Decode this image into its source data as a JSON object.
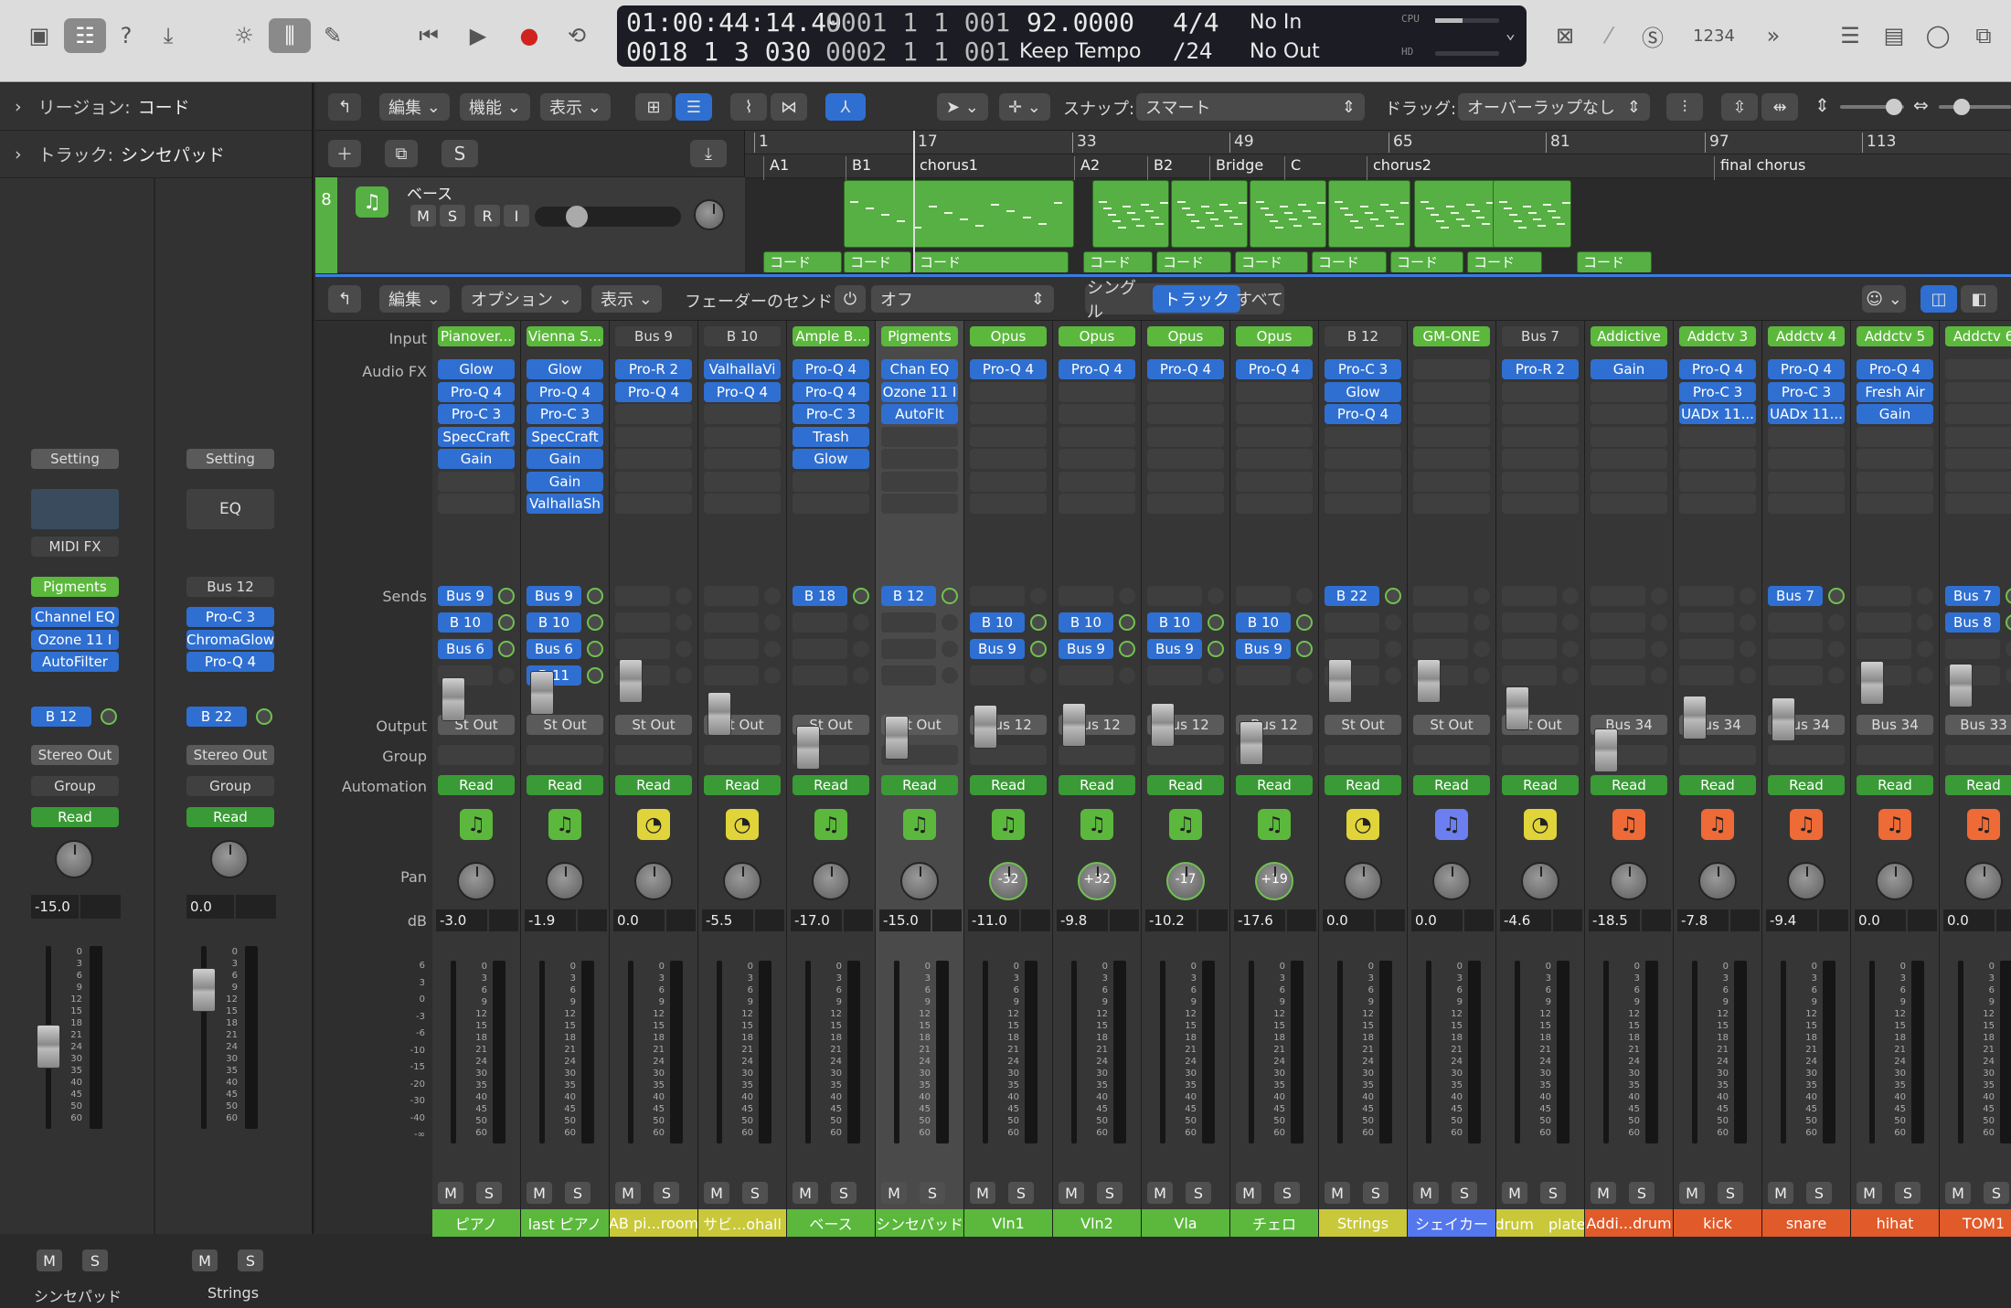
{
  "lcd": {
    "time": "01:00:44:14.49",
    "bars_a": "0001  1  1  001",
    "tempo": "92.0000",
    "sig": "4/4",
    "in": "No In",
    "beats": "0018  1  3  030",
    "bars_b": "0002  1  1  001",
    "keep": "Keep Tempo",
    "div": "/24",
    "out": "No Out",
    "cpu": "CPU",
    "hd": "HD"
  },
  "toolbar_right": {
    "count": "1234",
    "more": "»"
  },
  "inspector": {
    "region_label": "リージョン:",
    "region_value": "コード",
    "track_label": "トラック:",
    "track_value": "シンセパッド"
  },
  "trackbar": {
    "edit": "編集",
    "func": "機能",
    "view": "表示",
    "snap_label": "スナップ:",
    "snap_value": "スマート",
    "drag_label": "ドラッグ:",
    "drag_value": "オーバーラップなし"
  },
  "track": {
    "num": "8",
    "name": "ベース",
    "m": "M",
    "s": "S",
    "r": "R",
    "i": "I",
    "s_btn": "S"
  },
  "ruler": [
    "1",
    "17",
    "33",
    "49",
    "65",
    "81",
    "97",
    "113"
  ],
  "markers": [
    "A1",
    "B1",
    "chorus1",
    "A2",
    "B2",
    "Bridge",
    "C",
    "chorus2",
    "final chorus"
  ],
  "chord_regions": [
    "コード",
    "コード",
    "コード",
    "コード",
    "コード",
    "コード",
    "コード",
    "コード",
    "コード",
    "コード"
  ],
  "mixerbar": {
    "edit": "編集",
    "options": "オプション",
    "view": "表示",
    "send_label": "フェーダーのセンド:",
    "send_value": "オフ",
    "single": "シングル",
    "track": "トラック",
    "all": "すべて"
  },
  "rowlabels": {
    "input": "Input",
    "fx": "Audio FX",
    "sends": "Sends",
    "output": "Output",
    "group": "Group",
    "automation": "Automation",
    "pan": "Pan",
    "db": "dB"
  },
  "inspector_strips": [
    {
      "setting": "Setting",
      "midifx": "MIDI FX",
      "input": "Pigments",
      "fx": [
        "Channel EQ",
        "Ozone 11 I",
        "AutoFilter"
      ],
      "send": "B 12",
      "output": "Stereo Out",
      "group": "Group",
      "auto": "Read",
      "db": "-15.0",
      "m": "M",
      "s": "S",
      "name": "シンセパッド"
    },
    {
      "setting": "Setting",
      "eq": "EQ",
      "input": "Bus 12",
      "fx": [
        "Pro-C 3",
        "ChromaGlow",
        "Pro-Q 4"
      ],
      "send": "B 22",
      "output": "Stereo Out",
      "group": "Group",
      "auto": "Read",
      "db": "0.0",
      "m": "M",
      "s": "S",
      "name": "Strings"
    }
  ],
  "strips": [
    {
      "input": "Pianover...",
      "fx": [
        "Glow",
        "Pro-Q 4",
        "Pro-C 3",
        "SpecCraft",
        "Gain"
      ],
      "sends": [
        "Bus 9",
        "B 10",
        "Bus 6",
        ""
      ],
      "output": "St Out",
      "auto": "Read",
      "pan": "",
      "db": "-3.0",
      "name": "ピアノ",
      "color": "#5bb83c",
      "icon": "♫",
      "iconbg": "#5bb83c"
    },
    {
      "input": "Vienna S...",
      "fx": [
        "Glow",
        "Pro-Q 4",
        "Pro-C 3",
        "SpecCraft",
        "Gain",
        "Gain",
        "ValhallaSh"
      ],
      "sends": [
        "Bus 9",
        "B 10",
        "Bus 6",
        "B 11"
      ],
      "output": "St Out",
      "auto": "Read",
      "pan": "",
      "db": "-1.9",
      "name": "last ピアノ",
      "color": "#5bb83c",
      "icon": "♫",
      "iconbg": "#5bb83c"
    },
    {
      "input": "Bus 9",
      "fx": [
        "Pro-R 2",
        "Pro-Q 4"
      ],
      "sends": [
        "",
        "",
        "",
        ""
      ],
      "output": "St Out",
      "auto": "Read",
      "pan": "",
      "db": "0.0",
      "name": "AB pi...room",
      "color": "#c8c83a",
      "icon": "◔",
      "iconbg": "#e0d43a"
    },
    {
      "input": "B 10",
      "fx": [
        "ValhallaVi",
        "Pro-Q 4"
      ],
      "sends": [
        "",
        "",
        "",
        ""
      ],
      "output": "St Out",
      "auto": "Read",
      "pan": "",
      "db": "-5.5",
      "name": "サビ...ohall",
      "color": "#c8c83a",
      "icon": "◔",
      "iconbg": "#e0d43a"
    },
    {
      "input": "Ample B...",
      "fx": [
        "Pro-Q 4",
        "Pro-Q 4",
        "Pro-C 3",
        "Trash",
        "Glow"
      ],
      "sends": [
        "B 18",
        "",
        "",
        ""
      ],
      "output": "St Out",
      "auto": "Read",
      "pan": "",
      "db": "-17.0",
      "name": "ベース",
      "color": "#5bb83c",
      "icon": "♫",
      "iconbg": "#5bb83c"
    },
    {
      "input": "Pigments",
      "fx": [
        "Chan EQ",
        "Ozone 11 I",
        "AutoFlt"
      ],
      "sends": [
        "B 12",
        "",
        "",
        ""
      ],
      "output": "St Out",
      "auto": "Read",
      "pan": "",
      "db": "-15.0",
      "name": "シンセパッド",
      "color": "#5bb83c",
      "icon": "♫",
      "iconbg": "#5bb83c"
    },
    {
      "input": "Opus",
      "fx": [
        "Pro-Q 4"
      ],
      "sends": [
        "",
        "B 10",
        "Bus 9",
        ""
      ],
      "output": "Bus 12",
      "auto": "Read",
      "pan": "-32",
      "db": "-11.0",
      "name": "Vln1",
      "color": "#5bb83c",
      "icon": "♫",
      "iconbg": "#5bb83c"
    },
    {
      "input": "Opus",
      "fx": [
        "Pro-Q 4"
      ],
      "sends": [
        "",
        "B 10",
        "Bus 9",
        ""
      ],
      "output": "Bus 12",
      "auto": "Read",
      "pan": "+32",
      "db": "-9.8",
      "name": "Vln2",
      "color": "#5bb83c",
      "icon": "♫",
      "iconbg": "#5bb83c"
    },
    {
      "input": "Opus",
      "fx": [
        "Pro-Q 4"
      ],
      "sends": [
        "",
        "B 10",
        "Bus 9",
        ""
      ],
      "output": "Bus 12",
      "auto": "Read",
      "pan": "-17",
      "db": "-10.2",
      "name": "Vla",
      "color": "#5bb83c",
      "icon": "♫",
      "iconbg": "#5bb83c"
    },
    {
      "input": "Opus",
      "fx": [
        "Pro-Q 4"
      ],
      "sends": [
        "",
        "B 10",
        "Bus 9",
        ""
      ],
      "output": "Bus 12",
      "auto": "Read",
      "pan": "+19",
      "db": "-17.6",
      "name": "チェロ",
      "color": "#5bb83c",
      "icon": "♫",
      "iconbg": "#5bb83c"
    },
    {
      "input": "B 12",
      "fx": [
        "Pro-C 3",
        "Glow",
        "Pro-Q 4"
      ],
      "sends": [
        "B 22",
        "",
        "",
        ""
      ],
      "output": "St Out",
      "auto": "Read",
      "pan": "",
      "db": "0.0",
      "name": "Strings",
      "color": "#c8c83a",
      "icon": "◔",
      "iconbg": "#e0d43a"
    },
    {
      "input": "GM-ONE",
      "fx": [],
      "sends": [
        "",
        "",
        "",
        ""
      ],
      "output": "St Out",
      "auto": "Read",
      "pan": "",
      "db": "0.0",
      "name": "シェイカー",
      "color": "#5577ee",
      "icon": "♫",
      "iconbg": "#6b7ff0"
    },
    {
      "input": "Bus 7",
      "fx": [
        "Pro-R 2"
      ],
      "sends": [
        "",
        "",
        "",
        ""
      ],
      "output": "St Out",
      "auto": "Read",
      "pan": "",
      "db": "-4.6",
      "name": "drum　plate",
      "color": "#c8c83a",
      "icon": "◔",
      "iconbg": "#e0d43a"
    },
    {
      "input": "Addictive",
      "fx": [
        "Gain"
      ],
      "sends": [
        "",
        "",
        "",
        ""
      ],
      "output": "Bus 34",
      "auto": "Read",
      "pan": "",
      "db": "-18.5",
      "name": "Addi...drum",
      "color": "#e05a2a",
      "icon": "♫",
      "iconbg": "#ee6a36"
    },
    {
      "input": "Addctv 3",
      "fx": [
        "Pro-Q 4",
        "Pro-C 3",
        "UADx 11..."
      ],
      "sends": [
        "",
        "",
        "",
        ""
      ],
      "output": "Bus 34",
      "auto": "Read",
      "pan": "",
      "db": "-7.8",
      "name": "kick",
      "color": "#e05a2a",
      "icon": "♫",
      "iconbg": "#ee6a36"
    },
    {
      "input": "Addctv 4",
      "fx": [
        "Pro-Q 4",
        "Pro-C 3",
        "UADx 11..."
      ],
      "sends": [
        "Bus 7",
        "",
        "",
        ""
      ],
      "output": "Bus 34",
      "auto": "Read",
      "pan": "",
      "db": "-9.4",
      "name": "snare",
      "color": "#e05a2a",
      "icon": "♫",
      "iconbg": "#ee6a36"
    },
    {
      "input": "Addctv 5",
      "fx": [
        "Pro-Q 4",
        "Fresh Air",
        "Gain"
      ],
      "sends": [
        "",
        "",
        "",
        ""
      ],
      "output": "Bus 34",
      "auto": "Read",
      "pan": "",
      "db": "0.0",
      "name": "hihat",
      "color": "#e05a2a",
      "icon": "♫",
      "iconbg": "#ee6a36"
    },
    {
      "input": "Addctv 6",
      "fx": [],
      "sends": [
        "Bus 7",
        "Bus 8",
        "",
        ""
      ],
      "output": "Bus 33",
      "auto": "Read",
      "pan": "",
      "db": "0.0",
      "name": "TOM1",
      "color": "#e05a2a",
      "icon": "♫",
      "iconbg": "#ee6a36"
    }
  ],
  "ms": {
    "m": "M",
    "s": "S"
  },
  "scale": [
    "0",
    "3",
    "6",
    "9",
    "12",
    "15",
    "18",
    "21",
    "24",
    "30",
    "35",
    "40",
    "45",
    "50",
    "60"
  ],
  "left_scale": [
    "6",
    "3",
    "0",
    "-3",
    "-6",
    "-10",
    "-15",
    "-20",
    "-30",
    "-40",
    "-∞"
  ]
}
